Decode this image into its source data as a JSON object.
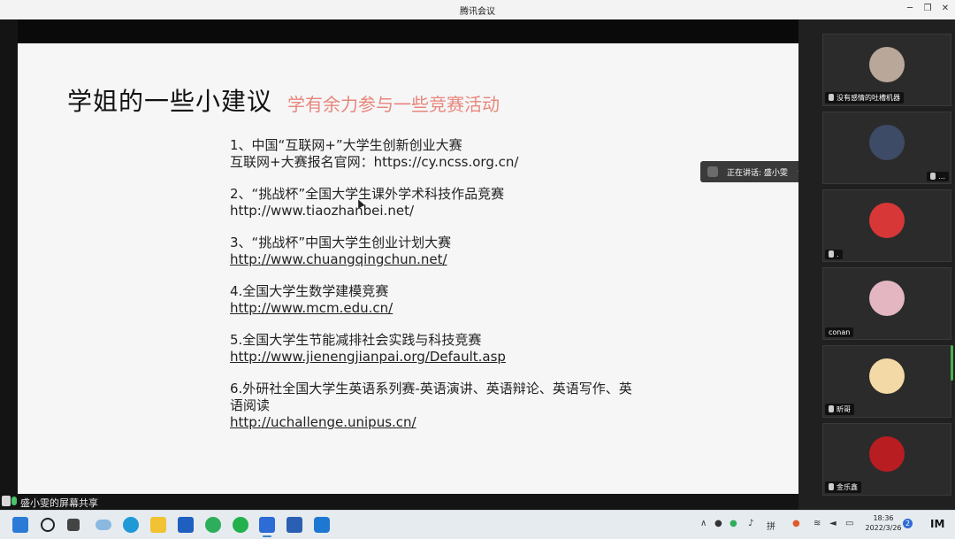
{
  "window": {
    "title": "腾讯会议"
  },
  "slide": {
    "title": "学姐的一些小建议",
    "subtitle": "学有余力参与一些竞赛活动",
    "items": [
      {
        "lines": [
          "1、中国“互联网+”大学生创新创业大赛",
          "互联网+大赛报名官网：https://cy.ncss.org.cn/"
        ]
      },
      {
        "lines": [
          "2、“挑战杯”全国大学生课外学术科技作品竞赛",
          "http://www.tiaozhanbei.net/"
        ]
      },
      {
        "lines": [
          "3、“挑战杯”中国大学生创业计划大赛",
          "http://www.chuangqingchun.net/"
        ]
      },
      {
        "lines": [
          "4.全国大学生数学建模竞赛",
          "http://www.mcm.edu.cn/"
        ]
      },
      {
        "lines": [
          "5.全国大学生节能减排社会实践与科技竞赛",
          "http://www.jienengjianpai.org/Default.asp"
        ]
      },
      {
        "lines": [
          "6.外研社全国大学生英语系列赛-英语演讲、英语辩论、英语写作、英语阅读",
          "http://uchallenge.unipus.cn/"
        ]
      }
    ]
  },
  "speaking": {
    "text": "正在讲话: 盛小雯"
  },
  "share_label": "盛小雯的屏幕共享",
  "participants": [
    {
      "name": "没有感情的吐槽机器",
      "color": "#b9a79a"
    },
    {
      "name": "...",
      "color": "#5e6f8e"
    },
    {
      "name": ".",
      "color": "#d73737"
    },
    {
      "name": "conan",
      "color": "#e3b6c2"
    },
    {
      "name": "昕哥",
      "color": "#f2d9a5"
    },
    {
      "name": "金乐鑫",
      "color": "#b81d22"
    }
  ],
  "taskbar": {
    "time": "18:36",
    "date": "2022/3/26",
    "notifications": "2",
    "icons": [
      "windows-start-icon",
      "search-icon",
      "task-view-icon",
      "cloud-icon",
      "edge-icon",
      "file-explorer-icon",
      "mail-icon",
      "edge-dev-icon",
      "wechat-icon",
      "tencent-meeting-icon",
      "word-icon",
      "notes-icon"
    ],
    "colors": {
      "accent": "#3b82c4"
    }
  }
}
